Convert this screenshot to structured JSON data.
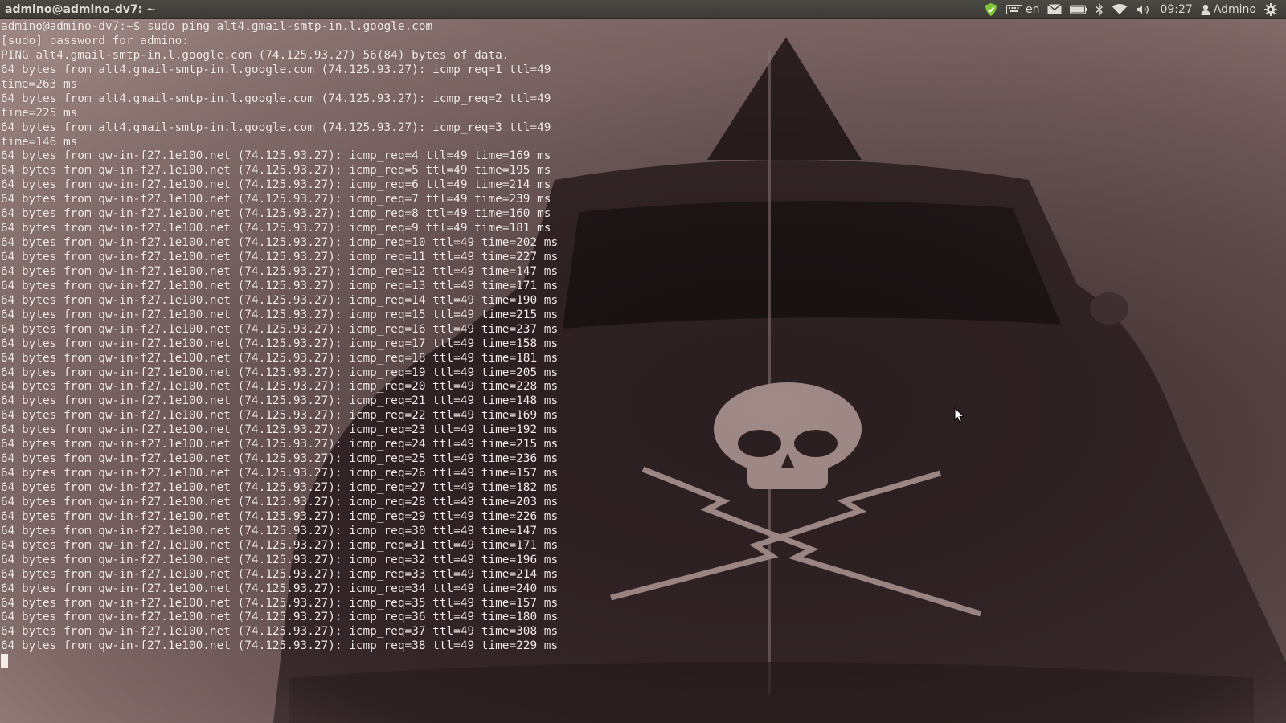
{
  "panel": {
    "window_title": "admino@admino-dv7: ~",
    "keyboard_layout": "en",
    "clock": "09:27",
    "user": "Admino",
    "icons": [
      "update-shield-icon",
      "keyboard-icon",
      "mail-icon",
      "battery-icon",
      "bluetooth-icon",
      "wifi-icon",
      "volume-icon",
      "user-icon",
      "gear-icon"
    ]
  },
  "terminal": {
    "lines": [
      "admino@admino-dv7:~$ sudo ping alt4.gmail-smtp-in.l.google.com",
      "[sudo] password for admino:",
      "PING alt4.gmail-smtp-in.l.google.com (74.125.93.27) 56(84) bytes of data.",
      "64 bytes from alt4.gmail-smtp-in.l.google.com (74.125.93.27): icmp_req=1 ttl=49",
      "time=263 ms",
      "64 bytes from alt4.gmail-smtp-in.l.google.com (74.125.93.27): icmp_req=2 ttl=49",
      "time=225 ms",
      "64 bytes from alt4.gmail-smtp-in.l.google.com (74.125.93.27): icmp_req=3 ttl=49",
      "time=146 ms",
      "64 bytes from qw-in-f27.1e100.net (74.125.93.27): icmp_req=4 ttl=49 time=169 ms",
      "64 bytes from qw-in-f27.1e100.net (74.125.93.27): icmp_req=5 ttl=49 time=195 ms",
      "64 bytes from qw-in-f27.1e100.net (74.125.93.27): icmp_req=6 ttl=49 time=214 ms",
      "64 bytes from qw-in-f27.1e100.net (74.125.93.27): icmp_req=7 ttl=49 time=239 ms",
      "64 bytes from qw-in-f27.1e100.net (74.125.93.27): icmp_req=8 ttl=49 time=160 ms",
      "64 bytes from qw-in-f27.1e100.net (74.125.93.27): icmp_req=9 ttl=49 time=181 ms",
      "64 bytes from qw-in-f27.1e100.net (74.125.93.27): icmp_req=10 ttl=49 time=202 ms",
      "64 bytes from qw-in-f27.1e100.net (74.125.93.27): icmp_req=11 ttl=49 time=227 ms",
      "64 bytes from qw-in-f27.1e100.net (74.125.93.27): icmp_req=12 ttl=49 time=147 ms",
      "64 bytes from qw-in-f27.1e100.net (74.125.93.27): icmp_req=13 ttl=49 time=171 ms",
      "64 bytes from qw-in-f27.1e100.net (74.125.93.27): icmp_req=14 ttl=49 time=190 ms",
      "64 bytes from qw-in-f27.1e100.net (74.125.93.27): icmp_req=15 ttl=49 time=215 ms",
      "64 bytes from qw-in-f27.1e100.net (74.125.93.27): icmp_req=16 ttl=49 time=237 ms",
      "64 bytes from qw-in-f27.1e100.net (74.125.93.27): icmp_req=17 ttl=49 time=158 ms",
      "64 bytes from qw-in-f27.1e100.net (74.125.93.27): icmp_req=18 ttl=49 time=181 ms",
      "64 bytes from qw-in-f27.1e100.net (74.125.93.27): icmp_req=19 ttl=49 time=205 ms",
      "64 bytes from qw-in-f27.1e100.net (74.125.93.27): icmp_req=20 ttl=49 time=228 ms",
      "64 bytes from qw-in-f27.1e100.net (74.125.93.27): icmp_req=21 ttl=49 time=148 ms",
      "64 bytes from qw-in-f27.1e100.net (74.125.93.27): icmp_req=22 ttl=49 time=169 ms",
      "64 bytes from qw-in-f27.1e100.net (74.125.93.27): icmp_req=23 ttl=49 time=192 ms",
      "64 bytes from qw-in-f27.1e100.net (74.125.93.27): icmp_req=24 ttl=49 time=215 ms",
      "64 bytes from qw-in-f27.1e100.net (74.125.93.27): icmp_req=25 ttl=49 time=236 ms",
      "64 bytes from qw-in-f27.1e100.net (74.125.93.27): icmp_req=26 ttl=49 time=157 ms",
      "64 bytes from qw-in-f27.1e100.net (74.125.93.27): icmp_req=27 ttl=49 time=182 ms",
      "64 bytes from qw-in-f27.1e100.net (74.125.93.27): icmp_req=28 ttl=49 time=203 ms",
      "64 bytes from qw-in-f27.1e100.net (74.125.93.27): icmp_req=29 ttl=49 time=226 ms",
      "64 bytes from qw-in-f27.1e100.net (74.125.93.27): icmp_req=30 ttl=49 time=147 ms",
      "64 bytes from qw-in-f27.1e100.net (74.125.93.27): icmp_req=31 ttl=49 time=171 ms",
      "64 bytes from qw-in-f27.1e100.net (74.125.93.27): icmp_req=32 ttl=49 time=196 ms",
      "64 bytes from qw-in-f27.1e100.net (74.125.93.27): icmp_req=33 ttl=49 time=214 ms",
      "64 bytes from qw-in-f27.1e100.net (74.125.93.27): icmp_req=34 ttl=49 time=240 ms",
      "64 bytes from qw-in-f27.1e100.net (74.125.93.27): icmp_req=35 ttl=49 time=157 ms",
      "64 bytes from qw-in-f27.1e100.net (74.125.93.27): icmp_req=36 ttl=49 time=180 ms",
      "64 bytes from qw-in-f27.1e100.net (74.125.93.27): icmp_req=37 ttl=49 time=308 ms",
      "64 bytes from qw-in-f27.1e100.net (74.125.93.27): icmp_req=38 ttl=49 time=229 ms"
    ]
  },
  "colors": {
    "panel_bg": "#3c3b37",
    "panel_text": "#dfdbd2",
    "terminal_text": "#f3ece8",
    "shield_green": "#7ec836"
  }
}
